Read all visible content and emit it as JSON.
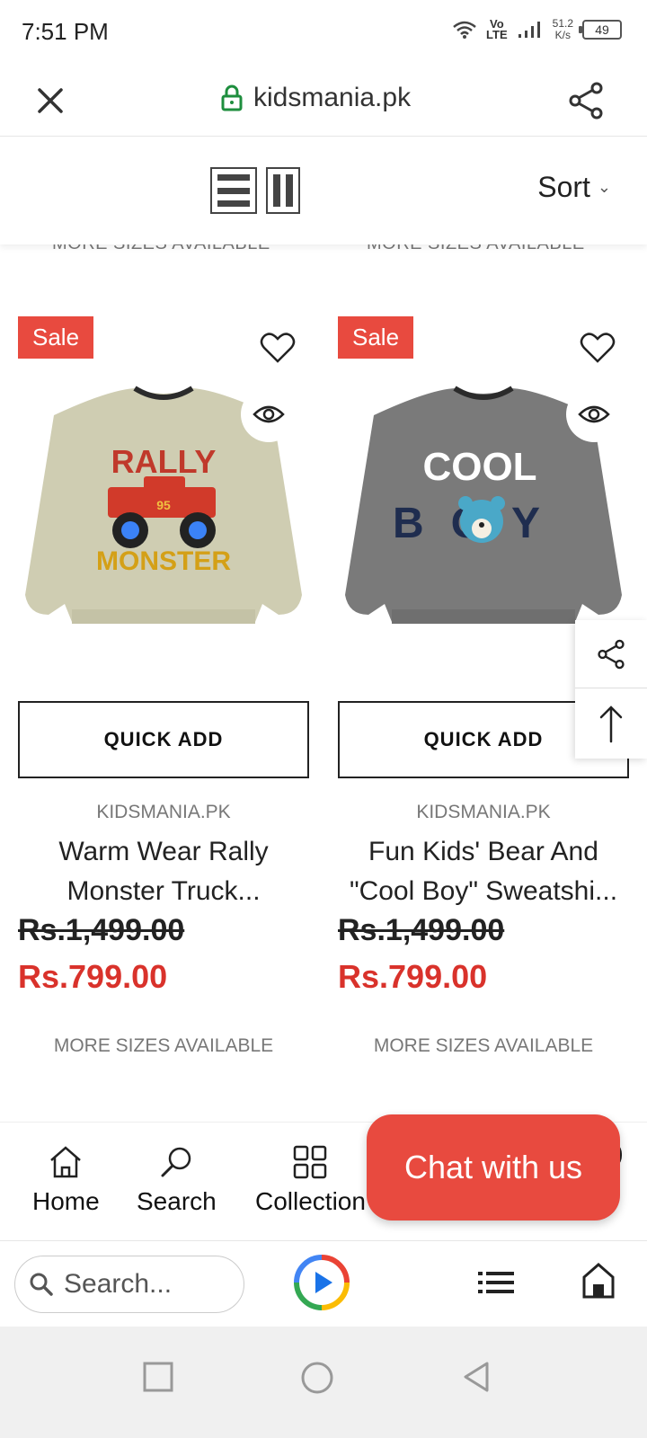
{
  "status": {
    "time": "7:51 PM",
    "volte_top": "Vo",
    "volte_bottom": "LTE",
    "speed_top": "51.2",
    "speed_bottom": "K/s",
    "battery": "49"
  },
  "browser": {
    "url": "kidsmania.pk",
    "search_placeholder": "Search..."
  },
  "toolbar": {
    "sort_label": "Sort"
  },
  "top_more_sizes": [
    "MORE SIZES AVAILABLE",
    "MORE SIZES AVAILABLE"
  ],
  "products": [
    {
      "badge": "Sale",
      "quick_add": "QUICK ADD",
      "vendor": "KIDSMANIA.PK",
      "title": "Warm Wear Rally Monster Truck...",
      "old_price": "Rs.1,499.00",
      "price": "Rs.799.00",
      "more_sizes": "MORE SIZES AVAILABLE",
      "graphic_text_1": "RALLY",
      "graphic_text_2": "MONSTER",
      "graphic_number": "95",
      "color": "#cfcdb2"
    },
    {
      "badge": "Sale",
      "quick_add": "QUICK ADD",
      "vendor": "KIDSMANIA.PK",
      "title": "Fun Kids' Bear And \"Cool Boy\" Sweatshi...",
      "old_price": "Rs.1,499.00",
      "price": "Rs.799.00",
      "more_sizes": "MORE SIZES AVAILABLE",
      "graphic_text_1": "COOL",
      "graphic_text_2": "BOY",
      "color": "#7a7a7a"
    }
  ],
  "app_nav": {
    "home": "Home",
    "search": "Search",
    "collection": "Collection"
  },
  "chat": {
    "label": "Chat with us"
  },
  "colors": {
    "sale": "#e84a3f",
    "price": "#d9322b",
    "url_lock": "#1e8e3e"
  }
}
